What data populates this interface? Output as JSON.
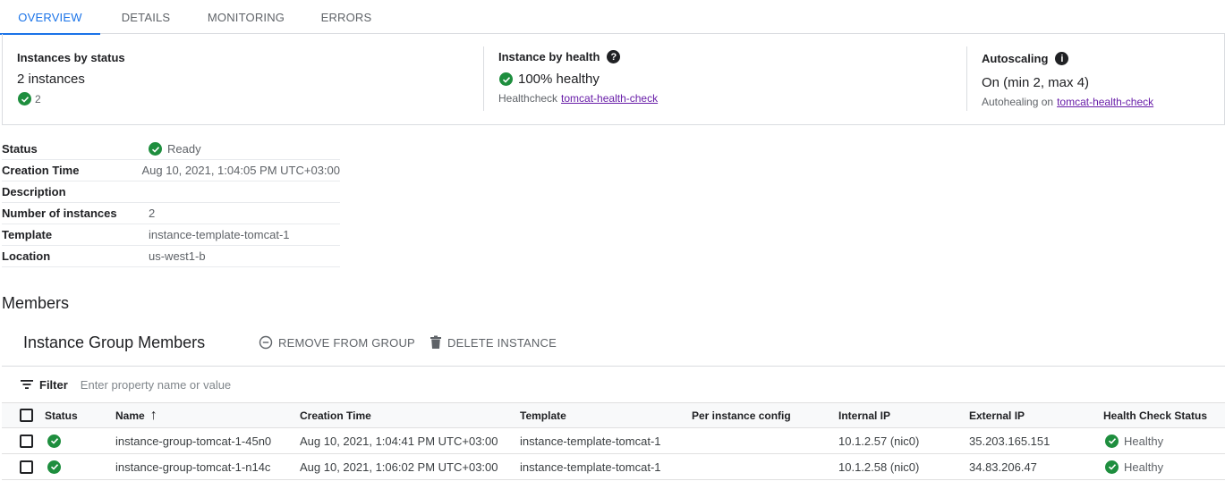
{
  "tabs": [
    {
      "label": "OVERVIEW",
      "active": true
    },
    {
      "label": "DETAILS",
      "active": false
    },
    {
      "label": "MONITORING",
      "active": false
    },
    {
      "label": "ERRORS",
      "active": false
    }
  ],
  "summary": {
    "instances": {
      "title": "Instances by status",
      "count_text": "2 instances",
      "ok_count": "2"
    },
    "health": {
      "title": "Instance by health",
      "value": "100% healthy",
      "healthcheck_label": "Healthcheck",
      "healthcheck_link": "tomcat-health-check"
    },
    "autoscaling": {
      "title": "Autoscaling",
      "value": "On (min 2, max 4)",
      "autohealing_label": "Autohealing on",
      "autohealing_link": "tomcat-health-check"
    }
  },
  "details": {
    "status_label": "Status",
    "status_value": "Ready",
    "creation_label": "Creation Time",
    "creation_value": "Aug 10, 2021, 1:04:05 PM UTC+03:00",
    "description_label": "Description",
    "description_value": "",
    "num_label": "Number of instances",
    "num_value": "2",
    "template_label": "Template",
    "template_value": "instance-template-tomcat-1",
    "location_label": "Location",
    "location_value": "us-west1-b"
  },
  "members": {
    "heading": "Members",
    "group_title": "Instance Group Members",
    "remove_label": "REMOVE FROM GROUP",
    "delete_label": "DELETE INSTANCE",
    "filter_label": "Filter",
    "filter_placeholder": "Enter property name or value",
    "columns": {
      "status": "Status",
      "name": "Name",
      "name_sort": "↑",
      "creation": "Creation Time",
      "template": "Template",
      "per_instance": "Per instance config",
      "internal_ip": "Internal IP",
      "external_ip": "External IP",
      "health": "Health Check Status"
    },
    "rows": [
      {
        "name": "instance-group-tomcat-1-45n0",
        "creation": "Aug 10, 2021, 1:04:41 PM UTC+03:00",
        "template": "instance-template-tomcat-1",
        "per_instance": "",
        "internal_ip": "10.1.2.57",
        "nic": "(nic0)",
        "external_ip": "35.203.165.151",
        "health": "Healthy"
      },
      {
        "name": "instance-group-tomcat-1-n14c",
        "creation": "Aug 10, 2021, 1:06:02 PM UTC+03:00",
        "template": "instance-template-tomcat-1",
        "per_instance": "",
        "internal_ip": "10.1.2.58",
        "nic": "(nic0)",
        "external_ip": "34.83.206.47",
        "health": "Healthy"
      }
    ]
  },
  "colors": {
    "accent": "#1a73e8",
    "ok": "#1e8e3e",
    "link": "#681da8"
  },
  "icons": [
    "check-circle-icon",
    "help-icon",
    "info-icon",
    "remove-circle-icon",
    "trash-icon",
    "filter-icon",
    "sort-up-icon"
  ]
}
